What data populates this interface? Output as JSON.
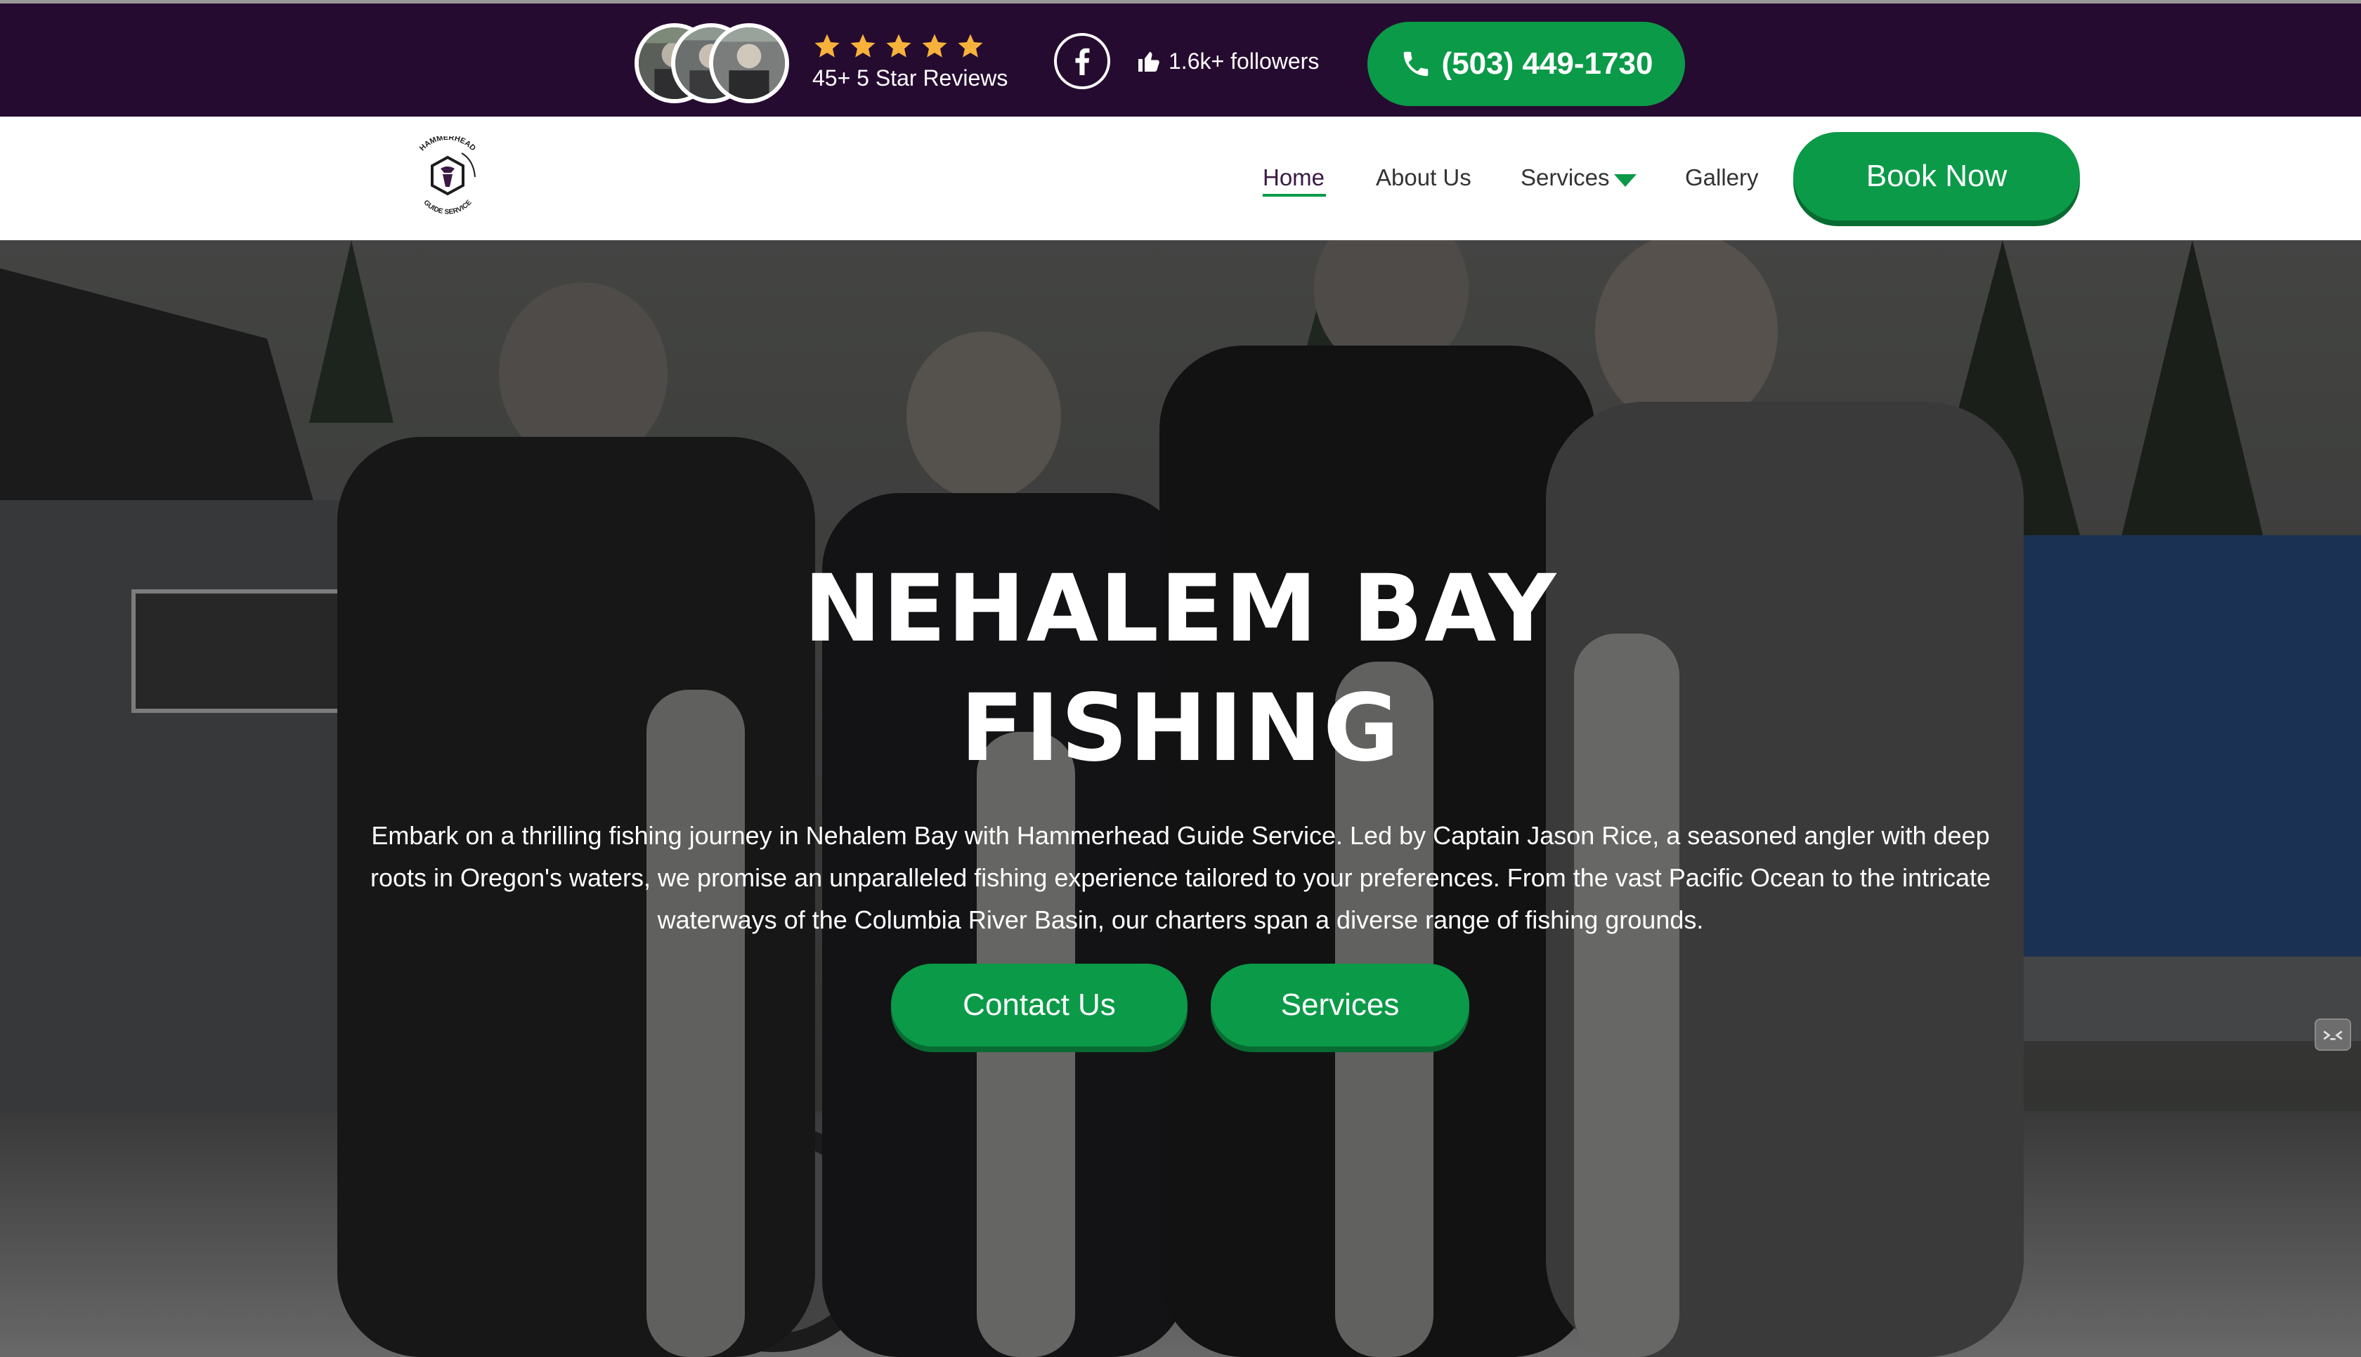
{
  "topbar": {
    "reviews_text": "45+ 5 Star Reviews",
    "star_count": 5,
    "star_color": "#f7b23b",
    "followers_text": "1.6k+ followers",
    "phone_label": "(503) 449-1730",
    "icons": [
      "reviewer-avatar",
      "star-icon",
      "facebook-icon",
      "thumbs-up-icon",
      "phone-icon"
    ]
  },
  "nav": {
    "logo_text_top": "HAMMERHEAD",
    "logo_text_bottom": "GUIDE SERVICE",
    "items": [
      {
        "label": "Home",
        "active": true
      },
      {
        "label": "About Us"
      },
      {
        "label": "Services"
      },
      {
        "label": "Gallery"
      }
    ],
    "book_label": "Book Now"
  },
  "hero": {
    "title_line1": "NEHALEM BAY",
    "title_line2": "FISHING",
    "description": "Embark on a thrilling fishing journey in Nehalem Bay with Hammerhead Guide Service. Led by Captain Jason Rice, a seasoned angler with deep roots in Oregon's waters, we promise an unparalleled fishing experience tailored to your preferences. From the vast Pacific Ocean to the intricate waterways of the Columbia River Basin, our charters span a diverse range of fishing grounds.",
    "contact_label": "Contact Us",
    "services_label": "Services"
  },
  "colors": {
    "topbar_bg": "#260b31",
    "accent_green": "#0b9a48",
    "nav_bg": "#ffffff",
    "text_white": "#ffffff"
  }
}
